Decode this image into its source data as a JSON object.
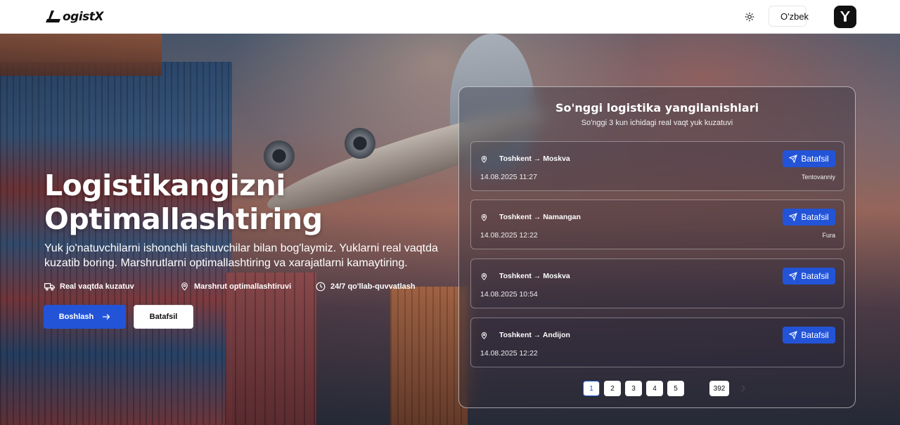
{
  "header": {
    "logo_text": "ogistX",
    "theme_icon": "sun-icon",
    "language": {
      "label": "O'zbek",
      "flag_colors": [
        "#1eb53a",
        "#ffffff",
        "#0099b5"
      ]
    },
    "avatar_icon": "user-avatar-icon"
  },
  "hero": {
    "title": "Logistikangizni Optimallashtiring",
    "subtitle": "Yuk jo'natuvchilarni ishonchli tashuvchilar bilan bog'laymiz. Yuklarni real vaqtda kuzatib boring. Marshrutlarni optimallashtiring va xarajatlarni kamaytiring.",
    "features": [
      {
        "icon": "truck-icon",
        "label": "Real vaqtda kuzatuv"
      },
      {
        "icon": "map-pin-icon",
        "label": "Marshrut optimallashtiruvi"
      },
      {
        "icon": "clock-icon",
        "label": "24/7 qo'llab-quvvatlash"
      }
    ],
    "primary_button": "Boshlash",
    "secondary_button": "Batafsil"
  },
  "updates": {
    "title": "So'nggi logistika yangilanishlari",
    "subtitle": "So'nggi 3 kun ichidagi real vaqt yuk kuzatuvi",
    "items": [
      {
        "route": "Toshkent → Moskva",
        "date": "14.08.2025 11:27",
        "type": "Tentovanniy",
        "button": "Batafsil"
      },
      {
        "route": "Toshkent → Namangan",
        "date": "14.08.2025 12:22",
        "type": "Fura",
        "button": "Batafsil"
      },
      {
        "route": "Toshkent → Moskva",
        "date": "14.08.2025 10:54",
        "type": "",
        "button": "Batafsil"
      },
      {
        "route": "Toshkent → Andijon",
        "date": "14.08.2025 12:22",
        "type": "",
        "button": "Batafsil"
      }
    ],
    "pagination": {
      "pages": [
        "1",
        "2",
        "3",
        "4",
        "5"
      ],
      "last": "392",
      "current": "1"
    },
    "accent": "#2354d8"
  }
}
